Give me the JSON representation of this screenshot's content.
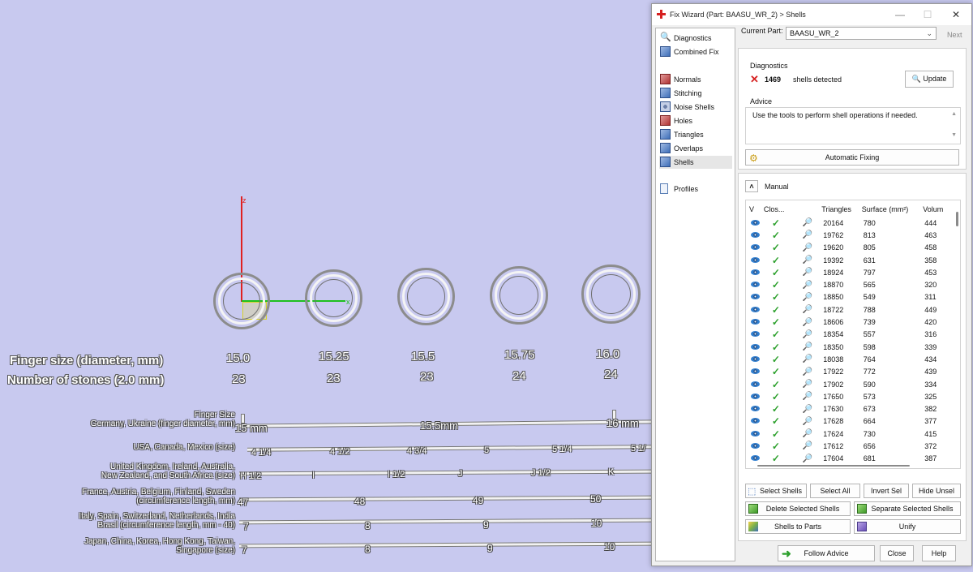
{
  "viewport": {
    "axis_z_label": "z",
    "axis_x_label": "x",
    "row_labels": {
      "finger_size": "Finger size (diameter, mm)",
      "stones": "Number of stones (2.0 mm)"
    },
    "ring_sizes": [
      "15.0",
      "15.25",
      "15.5",
      "15.75",
      "16.0"
    ],
    "stone_counts": [
      "23",
      "23",
      "23",
      "24",
      "24"
    ],
    "scale_labels": [
      {
        "line1": "Finger Size",
        "line2": "Germany, Ukraine (finger diameter, mm)"
      },
      {
        "line1": "",
        "line2": "USA, Canada, Mexico (size)"
      },
      {
        "line1": "United Kingdom, Ireland, Australia,",
        "line2": "New Zealand, and South Africa (size)"
      },
      {
        "line1": "France, Austria, Belgium, Finland, Sweden",
        "line2": "(circumference length, mm)"
      },
      {
        "line1": "Italy, Spain, Switzerland, Netherlands, India",
        "line2": "Brasil  (circumference length, mm - 40)"
      },
      {
        "line1": "Japan, China, Korea, Hong Kong, Taiwan,",
        "line2": "Singapore (size)"
      }
    ],
    "scale_values": [
      [
        "15 mm",
        "15.5mm",
        "16 mm"
      ],
      [
        "4 1/4",
        "4 1/2",
        "4 3/4",
        "5",
        "5 1/4",
        "5 1/"
      ],
      [
        "H 1/2",
        "I",
        "I 1/2",
        "J",
        "J 1/2",
        "K"
      ],
      [
        "47",
        "48",
        "49",
        "50"
      ],
      [
        "7",
        "8",
        "9",
        "10"
      ],
      [
        "7",
        "8",
        "9",
        "10"
      ]
    ]
  },
  "dialog": {
    "title": "Fix Wizard (Part: BAASU_WR_2) > Shells",
    "window_controls": {
      "minimize": "—",
      "maximize": "☐",
      "close": "✕"
    },
    "nav": {
      "top": [
        {
          "label": "Diagnostics",
          "icon": "diagnostics-magnifier-icon"
        },
        {
          "label": "Combined Fix",
          "icon": "combined-fix-icon"
        }
      ],
      "items": [
        {
          "label": "Normals",
          "icon": "normals-icon"
        },
        {
          "label": "Stitching",
          "icon": "stitching-icon"
        },
        {
          "label": "Noise Shells",
          "icon": "noise-shells-icon"
        },
        {
          "label": "Holes",
          "icon": "holes-icon"
        },
        {
          "label": "Triangles",
          "icon": "triangles-icon"
        },
        {
          "label": "Overlaps",
          "icon": "overlaps-icon"
        },
        {
          "label": "Shells",
          "icon": "shells-icon",
          "selected": true
        }
      ],
      "bottom": [
        {
          "label": "Profiles",
          "icon": "profiles-icon"
        }
      ]
    },
    "current_part_label": "Current Part:",
    "current_part_value": "BAASU_WR_2",
    "next_label": "Next",
    "diagnostics": {
      "title": "Diagnostics",
      "count": "1469",
      "text": "shells detected",
      "update_label": "Update"
    },
    "advice": {
      "title": "Advice",
      "text": "Use the tools to perform shell operations if needed."
    },
    "automatic_fixing_label": "Automatic Fixing",
    "manual_label": "Manual",
    "table": {
      "columns": [
        "V",
        "Clos...",
        "",
        "Triangles",
        "Surface (mm²)",
        "Volum"
      ],
      "rows": [
        [
          "20164",
          "780",
          "444"
        ],
        [
          "19762",
          "813",
          "463"
        ],
        [
          "19620",
          "805",
          "458"
        ],
        [
          "19392",
          "631",
          "358"
        ],
        [
          "18924",
          "797",
          "453"
        ],
        [
          "18870",
          "565",
          "320"
        ],
        [
          "18850",
          "549",
          "311"
        ],
        [
          "18722",
          "788",
          "449"
        ],
        [
          "18606",
          "739",
          "420"
        ],
        [
          "18354",
          "557",
          "316"
        ],
        [
          "18350",
          "598",
          "339"
        ],
        [
          "18038",
          "764",
          "434"
        ],
        [
          "17922",
          "772",
          "439"
        ],
        [
          "17902",
          "590",
          "334"
        ],
        [
          "17650",
          "573",
          "325"
        ],
        [
          "17630",
          "673",
          "382"
        ],
        [
          "17628",
          "664",
          "377"
        ],
        [
          "17624",
          "730",
          "415"
        ],
        [
          "17612",
          "656",
          "372"
        ],
        [
          "17604",
          "681",
          "387"
        ]
      ]
    },
    "buttons": {
      "select_shells": "Select Shells",
      "select_all": "Select All",
      "invert_sel": "Invert Sel",
      "hide_unsel": "Hide Unsel",
      "delete_selected": "Delete Selected Shells",
      "separate_selected": "Separate Selected Shells",
      "shells_to_parts": "Shells to Parts",
      "unify": "Unify",
      "follow_advice": "Follow Advice",
      "close": "Close",
      "help": "Help"
    },
    "colors": {
      "error": "#d62020",
      "ok": "#2ca02c",
      "selection": "#e6e6e6"
    }
  }
}
